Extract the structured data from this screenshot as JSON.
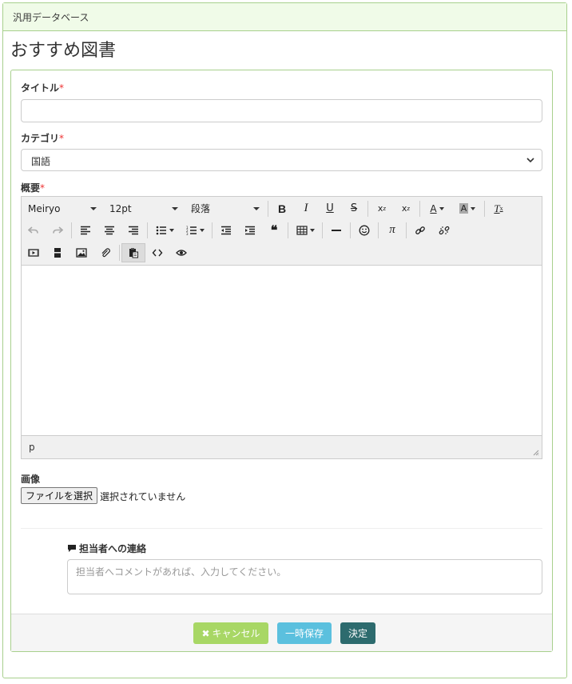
{
  "panel": {
    "heading": "汎用データベース"
  },
  "page": {
    "title": "おすすめ図書"
  },
  "form": {
    "title_label": "タイトル",
    "category_label": "カテゴリ",
    "category_value": "国語",
    "summary_label": "概要",
    "required_mark": "*",
    "image_label": "画像",
    "file_button": "ファイルを選択",
    "file_status": "選択されていません",
    "comment_label": "担当者への連絡",
    "comment_placeholder": "担当者へコメントがあれば、入力してください。"
  },
  "editor": {
    "font_family": "Meiryo",
    "font_size": "12pt",
    "format": "段落",
    "status_path": "p"
  },
  "footer": {
    "cancel": "キャンセル",
    "temp_save": "一時保存",
    "submit": "決定"
  }
}
